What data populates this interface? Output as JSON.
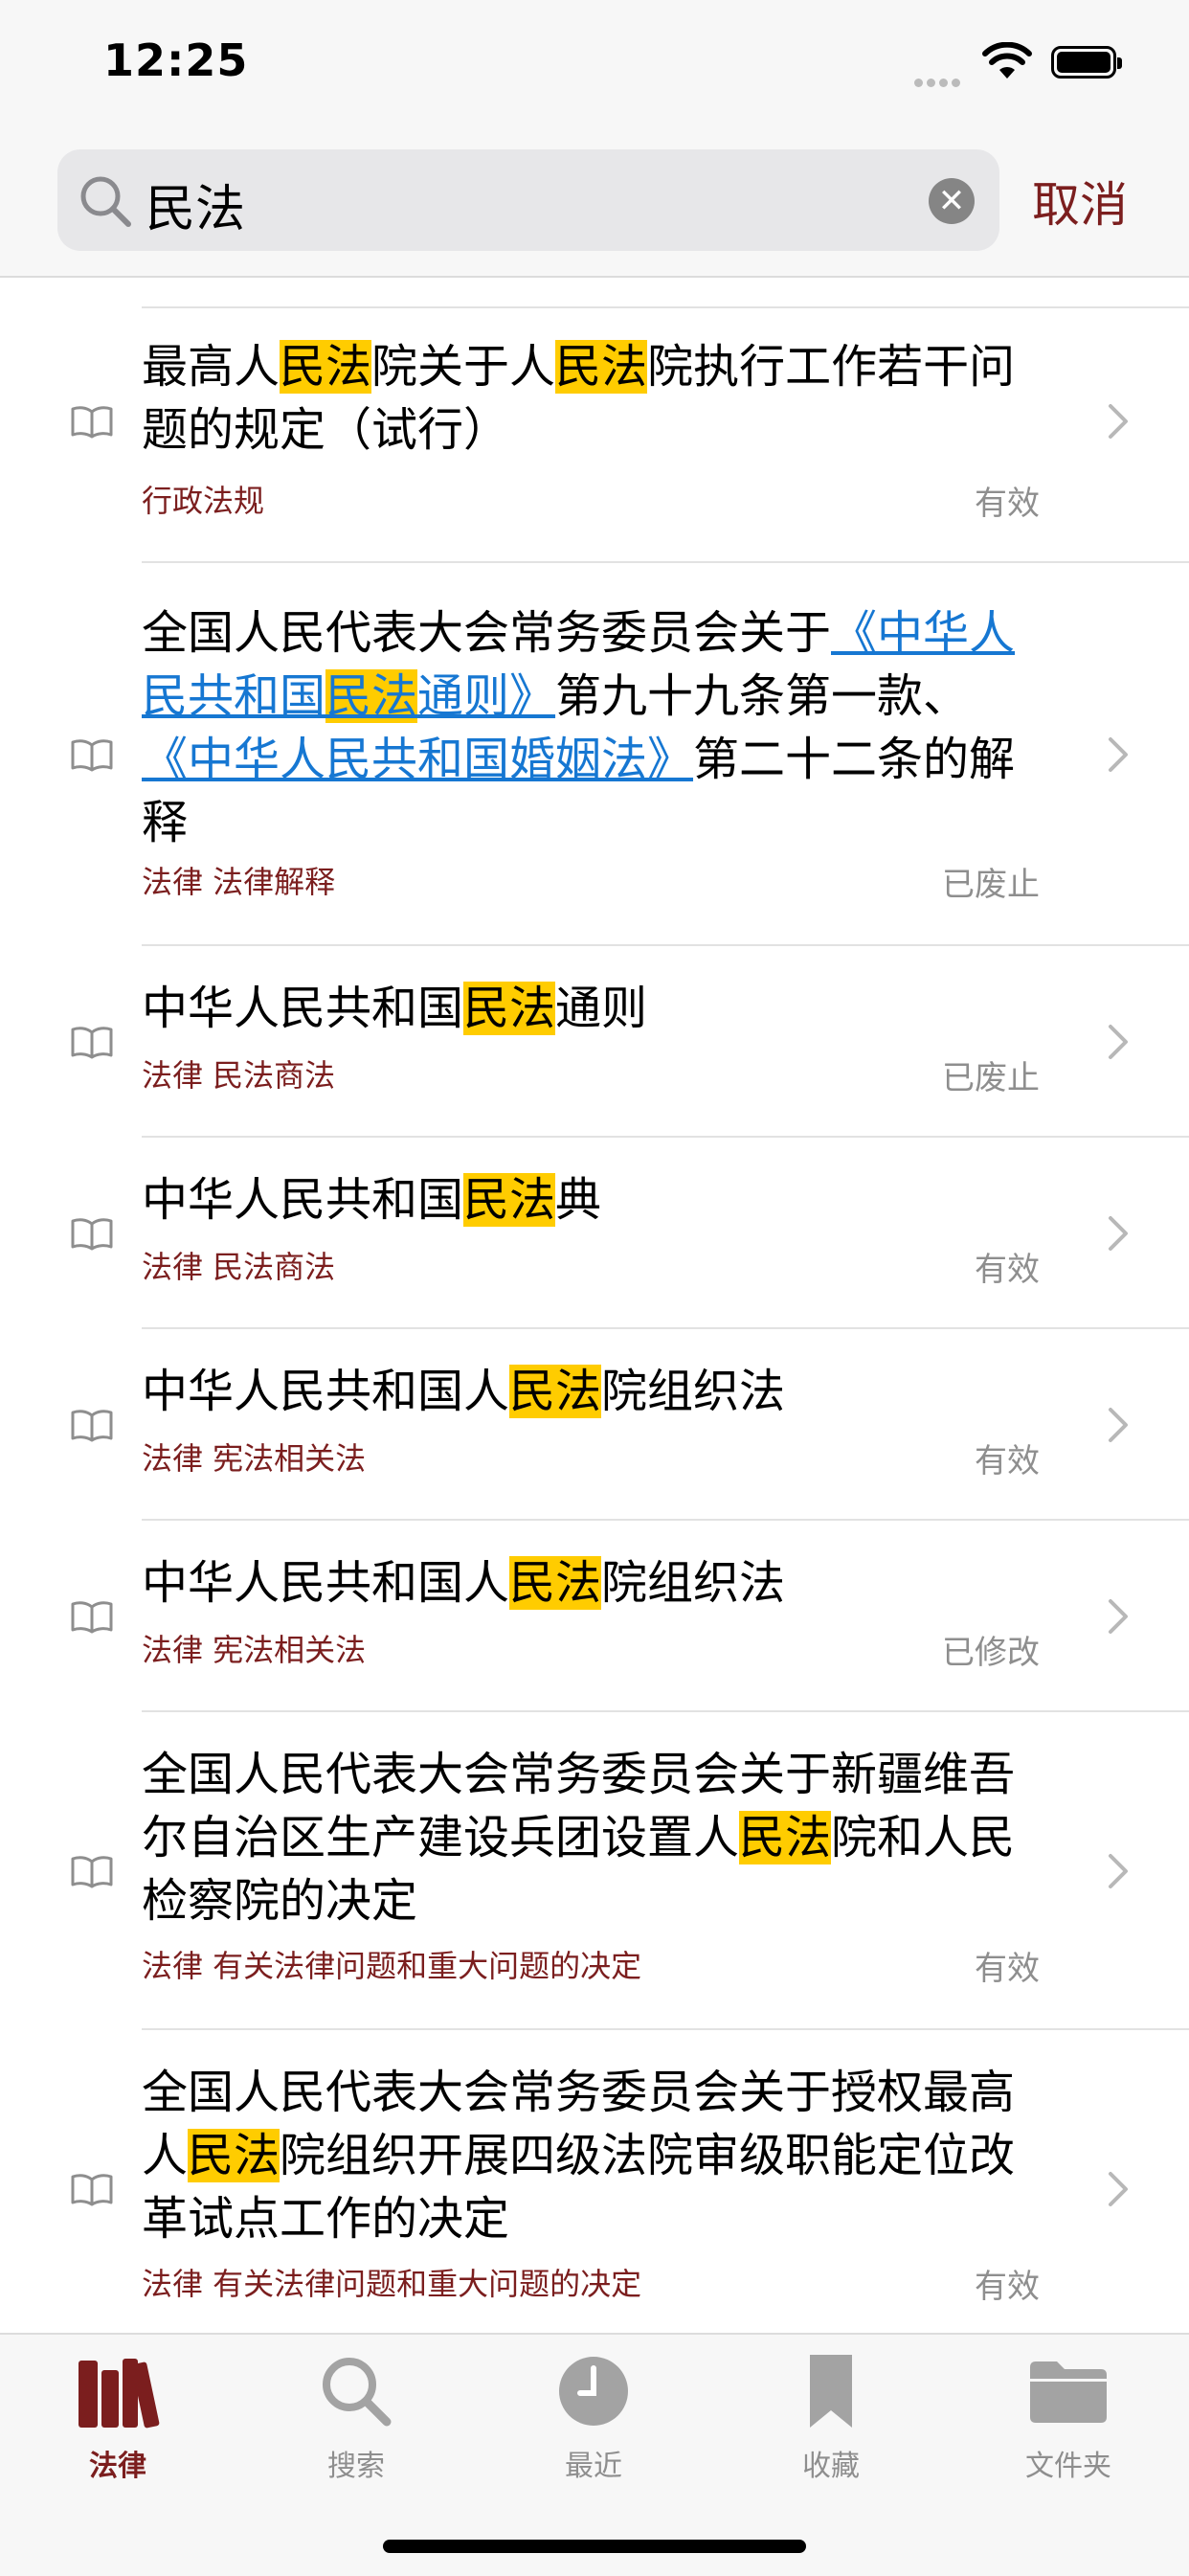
{
  "status_bar": {
    "time": "12:25"
  },
  "search": {
    "query": "民法",
    "cancel_label": "取消"
  },
  "results": [
    {
      "segments": [
        {
          "t": "最高人"
        },
        {
          "t": "民法",
          "hl": true
        },
        {
          "t": "院关于人"
        },
        {
          "t": "民法",
          "hl": true
        },
        {
          "t": "院执行工作若干问题的规定（试行）"
        }
      ],
      "category": "行政法规",
      "status": "有效"
    },
    {
      "segments": [
        {
          "t": "全国人民代表大会常务委员会关于"
        },
        {
          "t": "《中华人民共和国",
          "link": true
        },
        {
          "t": "民法",
          "hl": true,
          "link": true
        },
        {
          "t": "通则》",
          "link": true
        },
        {
          "t": "第九十九条第一款、"
        },
        {
          "t": "《中华人民共和国婚姻法》",
          "link": true
        },
        {
          "t": "第二十二条的解释"
        }
      ],
      "category": "法律 法律解释",
      "status": "已废止"
    },
    {
      "segments": [
        {
          "t": "中华人民共和国"
        },
        {
          "t": "民法",
          "hl": true
        },
        {
          "t": "通则"
        }
      ],
      "category": "法律 民法商法",
      "status": "已废止"
    },
    {
      "segments": [
        {
          "t": "中华人民共和国"
        },
        {
          "t": "民法",
          "hl": true
        },
        {
          "t": "典"
        }
      ],
      "category": "法律 民法商法",
      "status": "有效"
    },
    {
      "segments": [
        {
          "t": "中华人民共和国人"
        },
        {
          "t": "民法",
          "hl": true
        },
        {
          "t": "院组织法"
        }
      ],
      "category": "法律 宪法相关法",
      "status": "有效"
    },
    {
      "segments": [
        {
          "t": "中华人民共和国人"
        },
        {
          "t": "民法",
          "hl": true
        },
        {
          "t": "院组织法"
        }
      ],
      "category": "法律 宪法相关法",
      "status": "已修改"
    },
    {
      "segments": [
        {
          "t": "全国人民代表大会常务委员会关于新疆维吾尔自治区生产建设兵团设置人"
        },
        {
          "t": "民法",
          "hl": true
        },
        {
          "t": "院和人民检察院的决定"
        }
      ],
      "category": "法律 有关法律问题和重大问题的决定",
      "status": "有效"
    },
    {
      "segments": [
        {
          "t": "全国人民代表大会常务委员会关于授权最高人"
        },
        {
          "t": "民法",
          "hl": true
        },
        {
          "t": "院组织开展四级法院审级职能定位改革试点工作的决定"
        }
      ],
      "category": "法律 有关法律问题和重大问题的决定",
      "status": "有效"
    }
  ],
  "tabs": [
    {
      "label": "法律",
      "icon": "books-icon",
      "active": true
    },
    {
      "label": "搜索",
      "icon": "search-icon",
      "active": false
    },
    {
      "label": "最近",
      "icon": "clock-icon",
      "active": false
    },
    {
      "label": "收藏",
      "icon": "bookmark-icon",
      "active": false
    },
    {
      "label": "文件夹",
      "icon": "folder-icon",
      "active": false
    }
  ],
  "colors": {
    "accent": "#7b1e1e",
    "highlight": "#ffcc00",
    "link": "#1677d2",
    "muted": "#8e8e8e"
  }
}
